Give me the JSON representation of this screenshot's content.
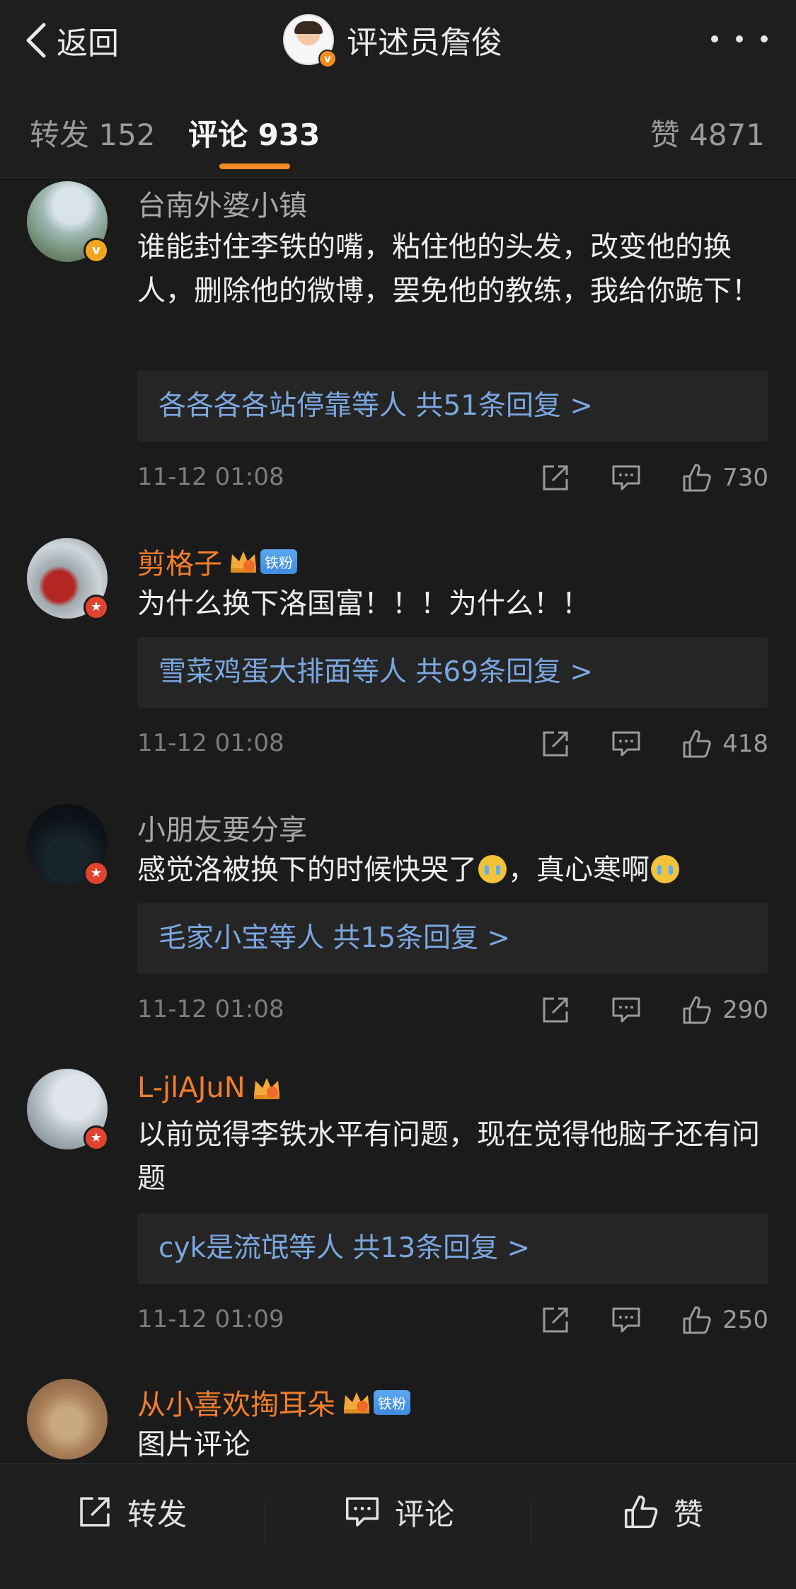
{
  "header": {
    "back_label": "返回",
    "title": "评述员詹俊",
    "verified_badge": "v"
  },
  "tabs": {
    "repost": "转发 152",
    "comments": "评论 933",
    "likes": "赞 4871"
  },
  "colors": {
    "accent": "#f08a23",
    "link": "#7ba7e0",
    "vip_name": "#f07d2e",
    "background": "#1b1b1b"
  },
  "comments": [
    {
      "user": "台南外婆小镇",
      "badge": "v",
      "text": "谁能封住李铁的嘴，粘住他的头发，改变他的换人，删除他的微博，罢免他的教练，我给你跪下！",
      "replies": "各各各各站停靠等人  共51条回复 >",
      "time": "11-12 01:08",
      "likes": "730"
    },
    {
      "user": "剪格子",
      "badge": "star",
      "fan_tag": "铁粉",
      "text": "为什么换下洛国富！！！为什么！！",
      "replies": "雪菜鸡蛋大排面等人  共69条回复 >",
      "time": "11-12 01:08",
      "likes": "418"
    },
    {
      "user": "小朋友要分享",
      "badge": "star",
      "text_a": "感觉洛被换下的时候快哭了",
      "text_b": "，真心寒啊",
      "replies": "毛家小宝等人  共15条回复 >",
      "time": "11-12 01:08",
      "likes": "290"
    },
    {
      "user": "L-jlAJuN",
      "badge": "star",
      "text": "以前觉得李铁水平有问题，现在觉得他脑子还有问题",
      "replies": "cyk是流氓等人  共13条回复 >",
      "time": "11-12 01:09",
      "likes": "250"
    },
    {
      "user": "从小喜欢掏耳朵",
      "fan_tag": "铁粉",
      "text": "图片评论"
    }
  ],
  "bottom_bar": {
    "repost": "转发",
    "comment": "评论",
    "like": "赞"
  }
}
